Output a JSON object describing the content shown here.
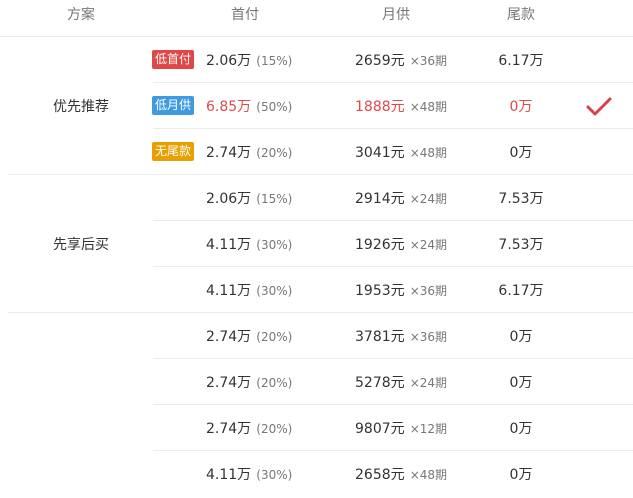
{
  "header": {
    "plan": "方案",
    "down": "首付",
    "monthly": "月供",
    "balloon": "尾款"
  },
  "colors": {
    "badge_red": "#e04848",
    "badge_blue": "#3f9ae0",
    "badge_orange": "#e8a000",
    "highlight": "#e04848",
    "check": "#d9424a"
  },
  "groups": [
    {
      "name": "优先推荐",
      "rows": [
        {
          "badge": "低首付",
          "badge_color": "red",
          "down": "2.06万",
          "down_pct": "(15%)",
          "monthly": "2659元",
          "term": "×36期",
          "balloon": "6.17万"
        },
        {
          "badge": "低月供",
          "badge_color": "blue",
          "down": "6.85万",
          "down_pct": "(50%)",
          "monthly": "1888元",
          "term": "×48期",
          "balloon": "0万",
          "selected": true,
          "check_icon": "checkmark-icon"
        },
        {
          "badge": "无尾款",
          "badge_color": "orange",
          "down": "2.74万",
          "down_pct": "(20%)",
          "monthly": "3041元",
          "term": "×48期",
          "balloon": "0万"
        }
      ]
    },
    {
      "name": "先享后买",
      "rows": [
        {
          "down": "2.06万",
          "down_pct": "(15%)",
          "monthly": "2914元",
          "term": "×24期",
          "balloon": "7.53万"
        },
        {
          "down": "4.11万",
          "down_pct": "(30%)",
          "monthly": "1926元",
          "term": "×24期",
          "balloon": "7.53万"
        },
        {
          "down": "4.11万",
          "down_pct": "(30%)",
          "monthly": "1953元",
          "term": "×36期",
          "balloon": "6.17万"
        }
      ]
    },
    {
      "name": "",
      "rows": [
        {
          "down": "2.74万",
          "down_pct": "(20%)",
          "monthly": "3781元",
          "term": "×36期",
          "balloon": "0万"
        },
        {
          "down": "2.74万",
          "down_pct": "(20%)",
          "monthly": "5278元",
          "term": "×24期",
          "balloon": "0万"
        },
        {
          "down": "2.74万",
          "down_pct": "(20%)",
          "monthly": "9807元",
          "term": "×12期",
          "balloon": "0万"
        },
        {
          "down": "4.11万",
          "down_pct": "(30%)",
          "monthly": "2658元",
          "term": "×48期",
          "balloon": "0万"
        }
      ]
    }
  ]
}
